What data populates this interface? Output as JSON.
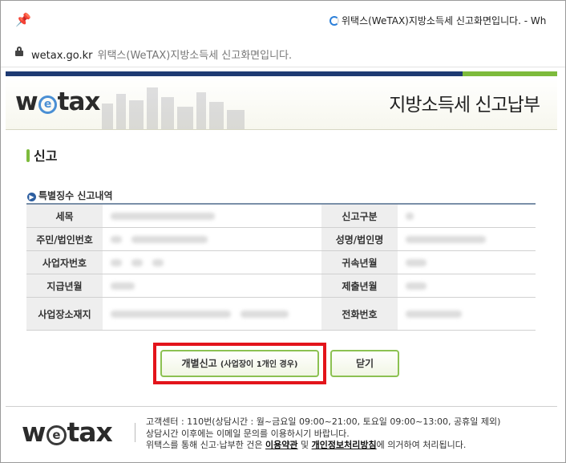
{
  "window": {
    "title": "위택스(WeTAX)지방소득세 신고화면입니다. - Wh"
  },
  "address": {
    "host": "wetax.go.kr",
    "page_title": "위택스(WeTAX)지방소득세 신고화면입니다."
  },
  "header": {
    "logo": "wetax",
    "system_name": "지방소득세 신고납부"
  },
  "section": {
    "title": "신고",
    "subtitle": "특별징수 신고내역"
  },
  "table": {
    "rows": [
      {
        "label1": "세목",
        "label2": "신고구분"
      },
      {
        "label1": "주민/법인번호",
        "label2": "성명/법인명"
      },
      {
        "label1": "사업자번호",
        "label2": "귀속년월"
      },
      {
        "label1": "지급년월",
        "label2": "제출년월"
      },
      {
        "label1": "사업장소재지",
        "label2": "전화번호"
      }
    ]
  },
  "buttons": {
    "individual_main": "개별신고",
    "individual_note": "(사업장이 1개인 경우)",
    "close": "닫기"
  },
  "footer": {
    "logo": "wetax",
    "line1": "고객센터 : 110번(상담시간 : 월~금요일 09:00~21:00, 토요일 09:00~13:00, 공휴일 제외)",
    "line2": "상담시간 이후에는 이메일 문의를 이용하시기 바랍니다.",
    "line3_prefix": "위택스를 통해 신고·납부한 건은 ",
    "terms_link": "이용약관",
    "line3_mid": " 및 ",
    "privacy_link": "개인정보처리방침",
    "line3_suffix": "에 의거하여 처리됩니다."
  },
  "colors": {
    "navy": "#1e3a73",
    "green": "#7dbb3c",
    "highlight_red": "#e3141b"
  }
}
